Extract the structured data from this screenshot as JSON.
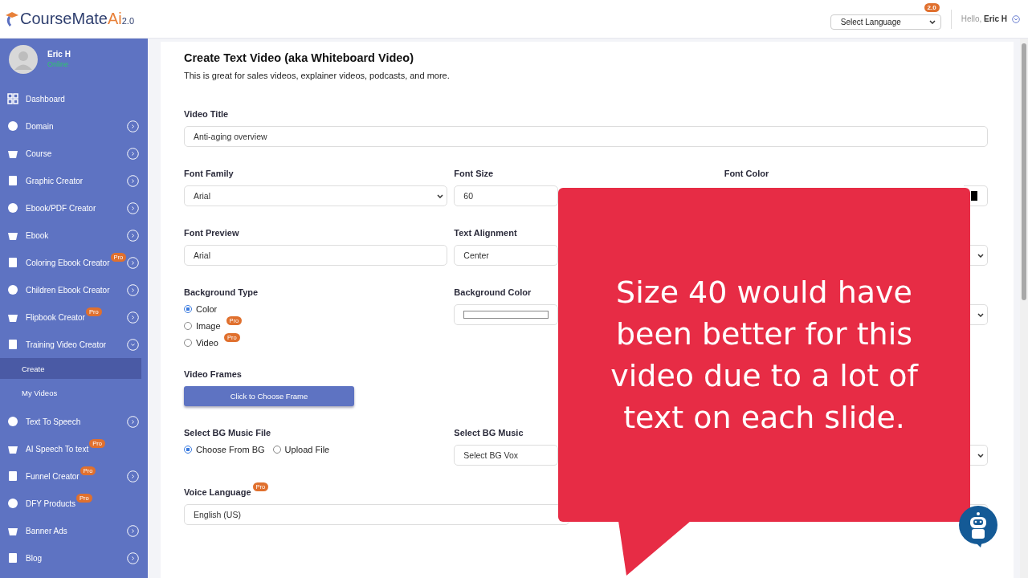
{
  "header": {
    "logo": {
      "name": "CourseMate",
      "ai": "Ai",
      "version": "2.0"
    },
    "version_badge": "2.0",
    "language_select": {
      "value": "Select Language"
    },
    "greeting": "Hello,",
    "user": "Eric H"
  },
  "sidebar": {
    "user": {
      "name": "Eric H",
      "status": "Online"
    },
    "items": [
      {
        "label": "Dashboard",
        "arrow": false
      },
      {
        "label": "Domain",
        "arrow": true,
        "expanded": false
      },
      {
        "label": "Course",
        "arrow": true,
        "expanded": false
      },
      {
        "label": "Graphic Creator",
        "arrow": true,
        "expanded": false
      },
      {
        "label": "Ebook/PDF Creator",
        "arrow": true,
        "expanded": false
      },
      {
        "label": "Ebook",
        "arrow": true,
        "expanded": false
      },
      {
        "label": "Coloring Ebook Creator",
        "badge": "Pro",
        "arrow": true,
        "expanded": false
      },
      {
        "label": "Children Ebook Creator",
        "arrow": true,
        "expanded": false
      },
      {
        "label": "Flipbook Creator",
        "badge": "Pro",
        "arrow": true,
        "expanded": false
      },
      {
        "label": "Training Video Creator",
        "arrow": true,
        "expanded": true,
        "children": [
          {
            "label": "Create",
            "selected": true
          },
          {
            "label": "My Videos",
            "selected": false
          }
        ]
      },
      {
        "label": "Text To Speech",
        "arrow": true,
        "expanded": false
      },
      {
        "label": "AI Speech To text",
        "badge": "Pro",
        "arrow": false
      },
      {
        "label": "Funnel Creator",
        "badge": "Pro",
        "arrow": true,
        "expanded": false
      },
      {
        "label": "DFY Products",
        "badge": "Pro",
        "arrow": false
      },
      {
        "label": "Banner Ads",
        "arrow": true,
        "expanded": false
      },
      {
        "label": "Blog",
        "arrow": true,
        "expanded": false
      }
    ]
  },
  "form": {
    "title": "Create Text Video (aka Whiteboard Video)",
    "subtitle": "This is great for sales videos, explainer videos, podcasts, and more.",
    "video_title": {
      "label": "Video Title",
      "value": "Anti-aging overview"
    },
    "font_family": {
      "label": "Font Family",
      "value": "Arial"
    },
    "font_size": {
      "label": "Font Size",
      "value": "60"
    },
    "font_color": {
      "label": "Font Color",
      "color": "#000000"
    },
    "font_preview": {
      "label": "Font Preview",
      "value": "Arial"
    },
    "text_alignment": {
      "label": "Text Alignment",
      "value": "Center"
    },
    "background_type": {
      "label": "Background Type",
      "options": [
        {
          "label": "Color",
          "selected": true
        },
        {
          "label": "Image",
          "selected": false,
          "badge": "Pro"
        },
        {
          "label": "Video",
          "selected": false,
          "badge": "Pro"
        }
      ]
    },
    "background_color": {
      "label": "Background Color"
    },
    "video_frames": {
      "label": "Video Frames",
      "button": "Click to Choose Frame"
    },
    "bg_music_file": {
      "label": "Select BG Music File",
      "options": [
        {
          "label": "Choose From BG",
          "selected": true
        },
        {
          "label": "Upload File",
          "selected": false
        }
      ]
    },
    "bg_music": {
      "label": "Select BG Music",
      "value": "Select BG Vox"
    },
    "voice_language": {
      "label": "Voice Language",
      "badge": "Pro",
      "value": "English (US)"
    }
  },
  "callout": {
    "text": "Size 40 would have been better for this video due to a lot of text on each slide."
  }
}
